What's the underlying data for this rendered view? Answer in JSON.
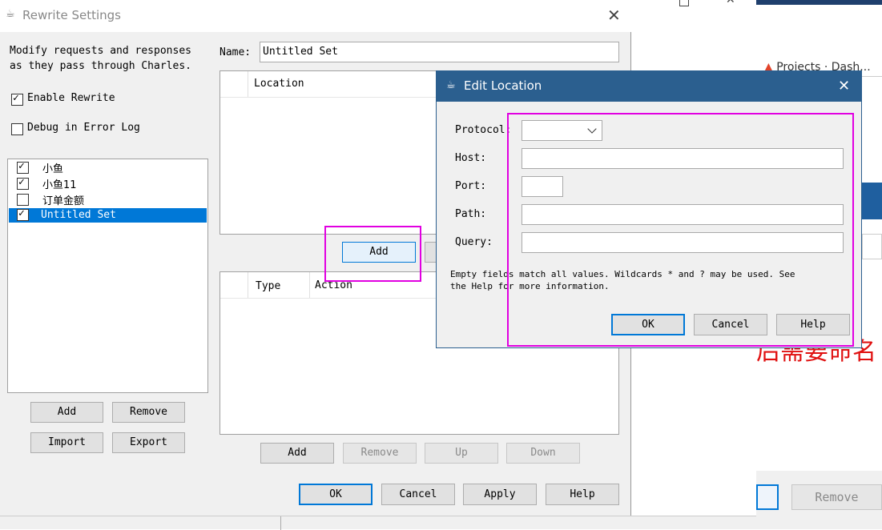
{
  "background": {
    "tab_title": "Projects · Dash...",
    "remove_label": "Remove",
    "red_text": "后需要命名"
  },
  "rewrite": {
    "title": "Rewrite Settings",
    "description_line1": "Modify requests and responses",
    "description_line2": "as they pass through Charles.",
    "enable_rewrite": "Enable Rewrite",
    "debug_log": "Debug in Error Log",
    "sets": [
      {
        "label": "小鱼",
        "checked": true
      },
      {
        "label": "小鱼11",
        "checked": true
      },
      {
        "label": "订单金额",
        "checked": false
      },
      {
        "label": "Untitled Set",
        "checked": true
      }
    ],
    "set_buttons": {
      "add": "Add",
      "remove": "Remove",
      "import": "Import",
      "export": "Export"
    },
    "name_label": "Name:",
    "name_value": "Untitled Set",
    "location_header": "Location",
    "location_add": "Add",
    "rules_header_type": "Type",
    "rules_header_action": "Action",
    "rule_buttons": {
      "add": "Add",
      "remove": "Remove",
      "up": "Up",
      "down": "Down"
    },
    "footer": {
      "ok": "OK",
      "cancel": "Cancel",
      "apply": "Apply",
      "help": "Help"
    }
  },
  "edit_location": {
    "title": "Edit Location",
    "protocol_label": "Protocol:",
    "protocol_value": "",
    "host_label": "Host:",
    "port_label": "Port:",
    "path_label": "Path:",
    "query_label": "Query:",
    "hint_line1": "Empty fields match all values. Wildcards * and ? may be used. See",
    "hint_line2": "the Help for more information.",
    "ok": "OK",
    "cancel": "Cancel",
    "help": "Help"
  },
  "colors": {
    "dialog_title_bg": "#2b5f8f",
    "highlight": "#e100e1",
    "selection": "#0078d7"
  }
}
